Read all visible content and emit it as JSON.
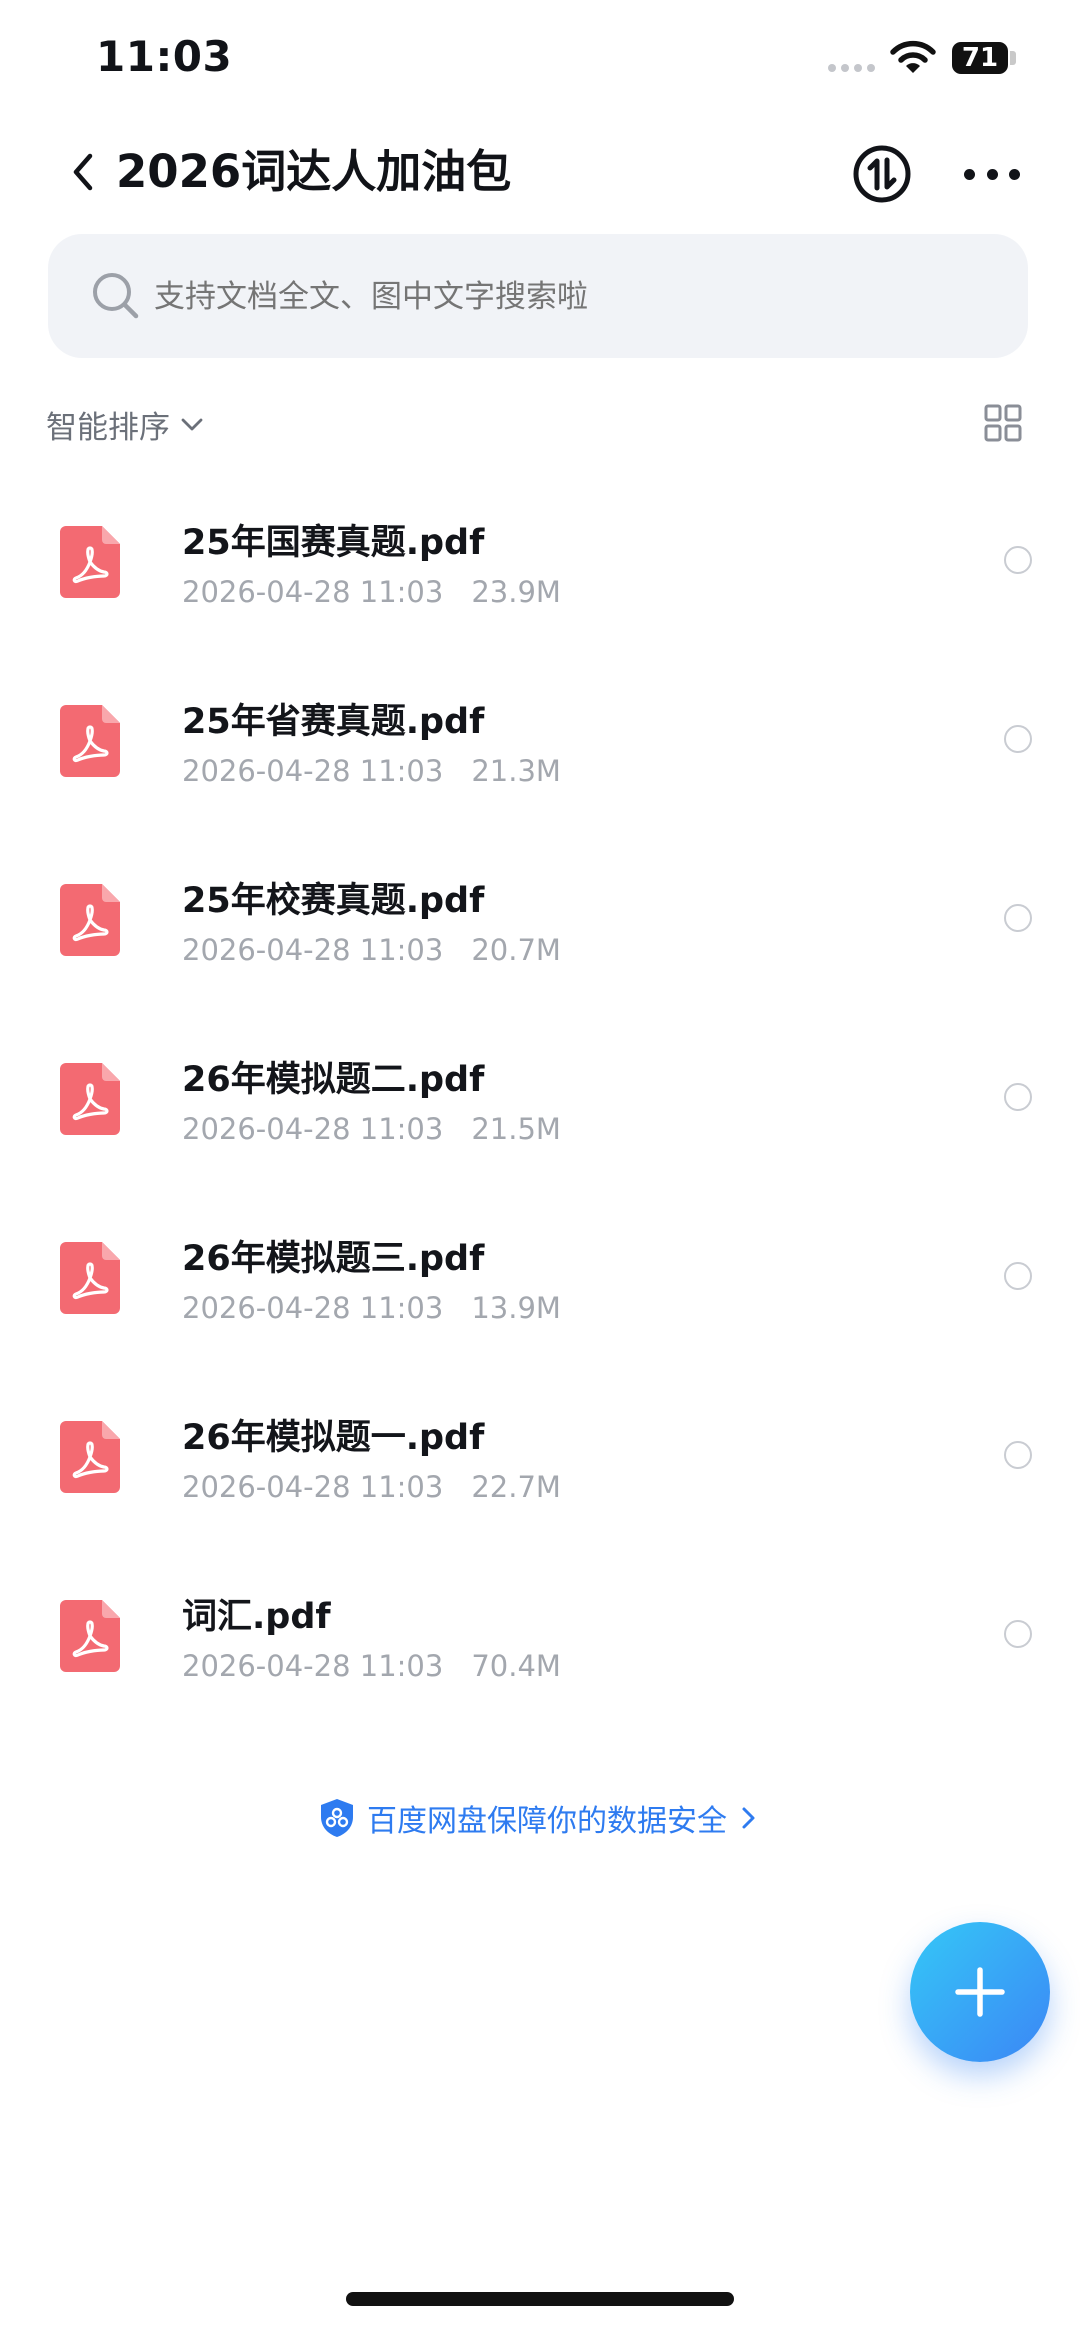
{
  "status_bar": {
    "time": "11:03",
    "battery": "71"
  },
  "nav": {
    "title": "2026词达人加油包"
  },
  "search": {
    "placeholder": "支持文档全文、图中文字搜索啦"
  },
  "sort": {
    "label": "智能排序"
  },
  "files": [
    {
      "name": "25年国赛真题.pdf",
      "date": "2026-04-28 11:03",
      "size": "23.9M"
    },
    {
      "name": "25年省赛真题.pdf",
      "date": "2026-04-28 11:03",
      "size": "21.3M"
    },
    {
      "name": "25年校赛真题.pdf",
      "date": "2026-04-28 11:03",
      "size": "20.7M"
    },
    {
      "name": "26年模拟题二.pdf",
      "date": "2026-04-28 11:03",
      "size": "21.5M"
    },
    {
      "name": "26年模拟题三.pdf",
      "date": "2026-04-28 11:03",
      "size": "13.9M"
    },
    {
      "name": "26年模拟题一.pdf",
      "date": "2026-04-28 11:03",
      "size": "22.7M"
    },
    {
      "name": "词汇.pdf",
      "date": "2026-04-28 11:03",
      "size": "70.4M"
    }
  ],
  "footer": {
    "security_text": "百度网盘保障你的数据安全"
  },
  "icons": {
    "file": "pdf-file-icon",
    "fab": "plus-icon",
    "sync": "sync-icon",
    "more": "more-icon",
    "shield": "shield-icon"
  },
  "colors": {
    "pdf_red": "#f36a72",
    "accent_blue": "#2e7bf0",
    "fab_gradient_start": "#35c8f7",
    "fab_gradient_end": "#3b86f5"
  }
}
